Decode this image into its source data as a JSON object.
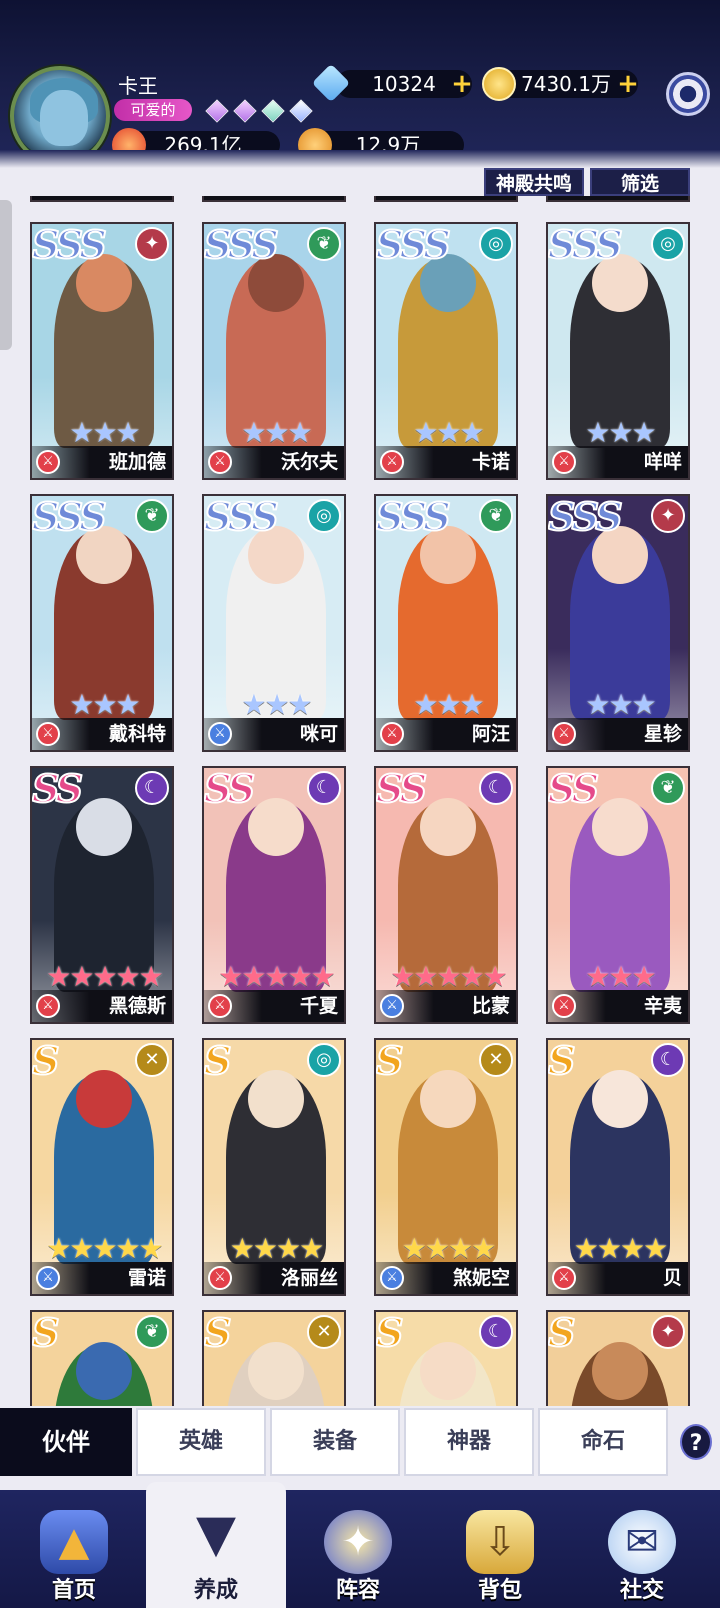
{
  "player": {
    "name": "卡王",
    "title_badge": "可爱的",
    "diamonds": "10324",
    "gold": "7430.1万",
    "power": "269.1亿",
    "energy": "12.9万",
    "icons": {
      "diamond": "diamond-icon",
      "gold": "gold-coin-icon",
      "power": "flame-icon",
      "energy": "orange-star-icon",
      "settings": "gear-icon"
    }
  },
  "top_buttons": {
    "resonance": "神殿共鸣",
    "filter": "筛选"
  },
  "heroes": [
    {
      "rank": "SSS",
      "name": "班加德",
      "stars": 3,
      "star_color": "#a9c6ff",
      "element_color": "#b43a4a",
      "class_color": "#e2404a",
      "bg": "#a8d6e6",
      "body": "#6e5a44",
      "skin": "#d98962"
    },
    {
      "rank": "SSS",
      "name": "沃尔夫",
      "stars": 3,
      "star_color": "#a9c6ff",
      "element_color": "#2f9a5a",
      "class_color": "#e2404a",
      "bg": "#a9d4ea",
      "body": "#c86a55",
      "skin": "#8e4b3a"
    },
    {
      "rank": "SSS",
      "name": "卡诺",
      "stars": 3,
      "star_color": "#a9c6ff",
      "element_color": "#1aa3a6",
      "class_color": "#e2404a",
      "bg": "#bfe1f0",
      "body": "#c79a3a",
      "skin": "#6aa0b8"
    },
    {
      "rank": "SSS",
      "name": "咩咩",
      "stars": 3,
      "star_color": "#a9c6ff",
      "element_color": "#1aa3a6",
      "class_color": "#e2404a",
      "bg": "#cfe8f0",
      "body": "#2e2e34",
      "skin": "#f4dccc"
    },
    {
      "rank": "SSS",
      "name": "戴科特",
      "stars": 3,
      "star_color": "#a9c6ff",
      "element_color": "#2f9a5a",
      "class_color": "#e2404a",
      "bg": "#bfe0ef",
      "body": "#8a3a2e",
      "skin": "#f1d5c2"
    },
    {
      "rank": "SSS",
      "name": "咪可",
      "stars": 3,
      "star_color": "#a9c6ff",
      "element_color": "#1aa3a6",
      "class_color": "#4a7fe0",
      "bg": "#d7ecf4",
      "body": "#f0f0f0",
      "skin": "#f4d8c8"
    },
    {
      "rank": "SSS",
      "name": "阿汪",
      "stars": 3,
      "star_color": "#a9c6ff",
      "element_color": "#2f9a5a",
      "class_color": "#e2404a",
      "bg": "#cfe8f2",
      "body": "#e56a2e",
      "skin": "#f2c3a8"
    },
    {
      "rank": "SSS",
      "name": "星轸",
      "stars": 3,
      "star_color": "#a9c6ff",
      "element_color": "#b43a4a",
      "class_color": "#e2404a",
      "bg": "#3a2c5c",
      "body": "#3b3b9a",
      "skin": "#f4d5c3"
    },
    {
      "rank": "SS",
      "name": "黑德斯",
      "stars": 5,
      "star_color": "#ff6b8a",
      "element_color": "#6d3ab4",
      "class_color": "#e2404a",
      "bg": "#2c3446",
      "body": "#1e2430",
      "skin": "#d9dde6"
    },
    {
      "rank": "SS",
      "name": "千夏",
      "stars": 5,
      "star_color": "#ff6b8a",
      "element_color": "#6d3ab4",
      "class_color": "#e2404a",
      "bg": "#f2c2b8",
      "body": "#8a3a8a",
      "skin": "#f6dccb"
    },
    {
      "rank": "SS",
      "name": "比蒙",
      "stars": 5,
      "star_color": "#ff6b8a",
      "element_color": "#6d3ab4",
      "class_color": "#4a7fe0",
      "bg": "#f6b9b0",
      "body": "#b56a3a",
      "skin": "#f6d6c1"
    },
    {
      "rank": "SS",
      "name": "辛夷",
      "stars": 3,
      "star_color": "#ff6b8a",
      "element_color": "#2f9a5a",
      "class_color": "#e2404a",
      "bg": "#f6c2b2",
      "body": "#9a5abf",
      "skin": "#f7dccd"
    },
    {
      "rank": "S",
      "name": "雷诺",
      "stars": 5,
      "star_color": "#ffd84a",
      "element_color": "#b58a1a",
      "class_color": "#4a7fe0",
      "bg": "#f6d7a1",
      "body": "#2a6aa0",
      "skin": "#c83a3a"
    },
    {
      "rank": "S",
      "name": "洛丽丝",
      "stars": 4,
      "star_color": "#ffd84a",
      "element_color": "#1aa3a6",
      "class_color": "#e2404a",
      "bg": "#f6d9a8",
      "body": "#2e2e34",
      "skin": "#f2e0cc"
    },
    {
      "rank": "S",
      "name": "煞妮空",
      "stars": 4,
      "star_color": "#ffd84a",
      "element_color": "#b58a1a",
      "class_color": "#4a7fe0",
      "bg": "#f2cf8e",
      "body": "#c88a3a",
      "skin": "#f6d8bd"
    },
    {
      "rank": "S",
      "name": "贝",
      "stars": 4,
      "star_color": "#ffd84a",
      "element_color": "#6d3ab4",
      "class_color": "#e2404a",
      "bg": "#f4d19a",
      "body": "#2c3460",
      "skin": "#f7e6da"
    },
    {
      "rank": "S",
      "name": "",
      "stars": 0,
      "star_color": "#ffd84a",
      "element_color": "#2f9a5a",
      "class_color": "#e2404a",
      "bg": "#f4d39c",
      "body": "#2e7a3a",
      "skin": "#3a6ab0"
    },
    {
      "rank": "S",
      "name": "",
      "stars": 0,
      "star_color": "#ffd84a",
      "element_color": "#b58a1a",
      "class_color": "#e2404a",
      "bg": "#f4d39c",
      "body": "#e0d0c0",
      "skin": "#f2e0cc"
    },
    {
      "rank": "S",
      "name": "",
      "stars": 0,
      "star_color": "#ffd84a",
      "element_color": "#6d3ab4",
      "class_color": "#e2404a",
      "bg": "#f6dca8",
      "body": "#f2e6c8",
      "skin": "#f6dcc6"
    },
    {
      "rank": "S",
      "name": "",
      "stars": 0,
      "star_color": "#ffd84a",
      "element_color": "#b43a4a",
      "class_color": "#e2404a",
      "bg": "#f2cf9a",
      "body": "#7a4a2a",
      "skin": "#c88a5a"
    }
  ],
  "sub_tabs": [
    "伙伴",
    "英雄",
    "装备",
    "神器",
    "命石"
  ],
  "help_label": "?",
  "bottom_nav": [
    {
      "label": "首页",
      "icon": "castle-gate-icon",
      "color": "#f2b53a"
    },
    {
      "label": "养成",
      "icon": "star-triangle-icon",
      "color": "#e8c430"
    },
    {
      "label": "阵容",
      "icon": "compass-star-icon",
      "color": "#e6c05a"
    },
    {
      "label": "背包",
      "icon": "backpack-icon",
      "color": "#f2d370"
    },
    {
      "label": "社交",
      "icon": "ghost-mail-icon",
      "color": "#eaf2ff"
    }
  ]
}
